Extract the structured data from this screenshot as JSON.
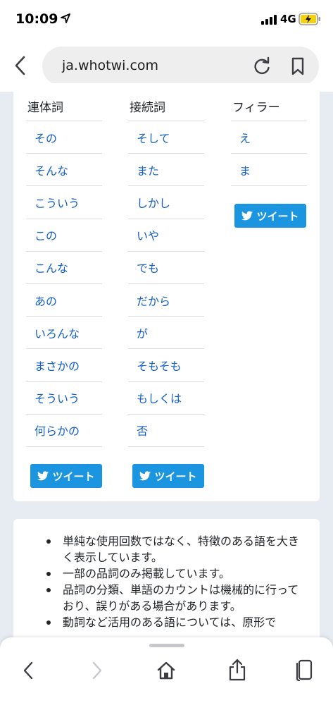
{
  "status_bar": {
    "time": "10:09",
    "network": "4G"
  },
  "address_bar": {
    "url": "ja.whotwi.com"
  },
  "columns": [
    {
      "heading": "連体詞",
      "words": [
        "その",
        "そんな",
        "こういう",
        "この",
        "こんな",
        "あの",
        "いろんな",
        "まさかの",
        "そういう",
        "何らかの"
      ],
      "tweet_label": "ツイート"
    },
    {
      "heading": "接続詞",
      "words": [
        "そして",
        "また",
        "しかし",
        "いや",
        "でも",
        "だから",
        "が",
        "そもそも",
        "もしくは",
        "否"
      ],
      "tweet_label": "ツイート"
    },
    {
      "heading": "フィラー",
      "words": [
        "え",
        "ま"
      ],
      "tweet_label": "ツイート"
    }
  ],
  "notes": [
    "単純な使用回数ではなく、特徴のある語を大きく表示しています。",
    "一部の品詞のみ掲載しています。",
    "品詞の分類、単語のカウントは機械的に行っており、誤りがある場合があります。",
    "動詞など活用のある語については、原形で"
  ],
  "colors": {
    "link": "#1560c5",
    "tweet_button": "#1b95e0",
    "page_bg": "#e7ebf2"
  }
}
